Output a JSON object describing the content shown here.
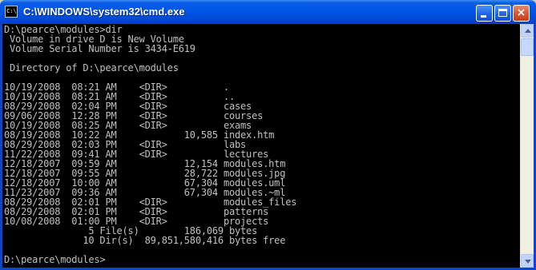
{
  "window": {
    "title": "C:\\WINDOWS\\system32\\cmd.exe",
    "icon_label": "C:\\",
    "close_glyph": "×"
  },
  "console": {
    "lines": [
      "D:\\pearce\\modules>dir",
      " Volume in drive D is New Volume",
      " Volume Serial Number is 3434-E619",
      "",
      " Directory of D:\\pearce\\modules",
      "",
      "10/19/2008  08:21 AM    <DIR>          .",
      "10/19/2008  08:21 AM    <DIR>          ..",
      "08/29/2008  02:04 PM    <DIR>          cases",
      "09/06/2008  12:28 PM    <DIR>          courses",
      "10/19/2008  08:25 AM    <DIR>          exams",
      "08/19/2008  10:22 AM            10,585 index.htm",
      "08/29/2008  02:03 PM    <DIR>          labs",
      "11/22/2008  09:41 AM    <DIR>          lectures",
      "12/18/2007  09:59 AM            12,154 modules.htm",
      "12/18/2007  09:55 AM            28,722 modules.jpg",
      "12/18/2007  10:00 AM            67,304 modules.uml",
      "11/23/2007  09:36 AM            67,304 modules.~ml",
      "08/29/2008  02:01 PM    <DIR>          modules_files",
      "08/29/2008  02:01 PM    <DIR>          patterns",
      "10/08/2008  01:00 PM    <DIR>          projects",
      "               5 File(s)        186,069 bytes",
      "              10 Dir(s)  89,851,580,416 bytes free",
      "",
      "D:\\pearce\\modules>"
    ]
  },
  "colors": {
    "titlebar": "#0054e3",
    "console_bg": "#000000",
    "console_text": "#c0c0c0"
  }
}
